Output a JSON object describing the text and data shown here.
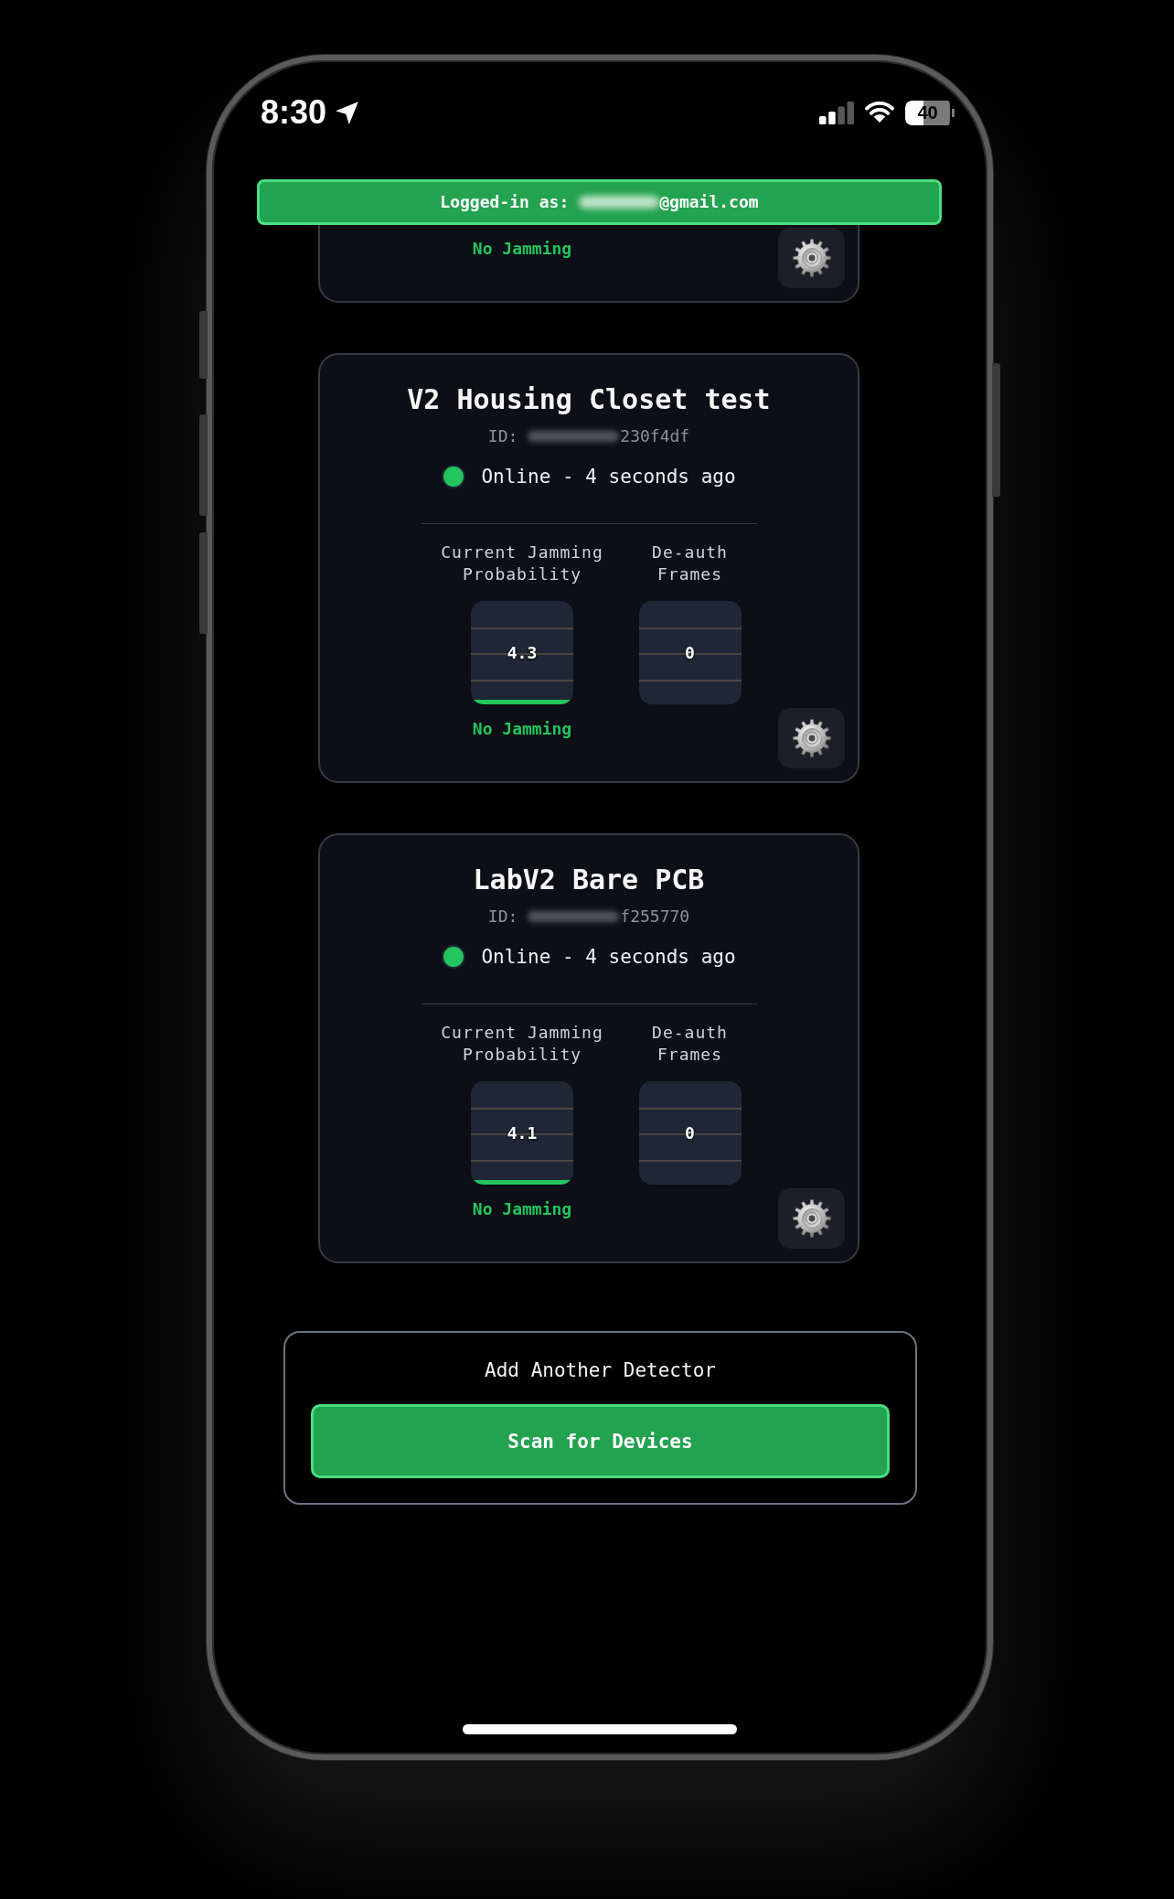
{
  "status_bar": {
    "time": "8:30",
    "battery": "40"
  },
  "login_banner": {
    "label": "Logged-in as:",
    "email_redacted": true,
    "email_domain": "@gmail.com"
  },
  "devices": [
    {
      "clipped_top": true,
      "metrics": [
        {
          "status": "No Jamming",
          "jamming": false
        }
      ]
    },
    {
      "clipped_top": false,
      "name": "V2 Housing Closet test",
      "id_label": "ID:",
      "id_redacted": true,
      "id_tail": "230f4df",
      "online": true,
      "last_seen": "Online - 4 seconds ago",
      "metrics": [
        {
          "label": "Current Jamming Probability",
          "value": "4.3",
          "level": 0.043,
          "status": "No Jamming",
          "jamming": false
        },
        {
          "label": "De-auth Frames",
          "value": "0"
        }
      ]
    },
    {
      "clipped_top": false,
      "name": "LabV2 Bare PCB",
      "id_label": "ID:",
      "id_redacted": true,
      "id_tail": "f255770",
      "online": true,
      "last_seen": "Online - 4 seconds ago",
      "metrics": [
        {
          "label": "Current Jamming Probability",
          "value": "4.1",
          "level": 0.041,
          "status": "No Jamming",
          "jamming": false
        },
        {
          "label": "De-auth Frames",
          "value": "0"
        }
      ]
    }
  ],
  "add_detector": {
    "title": "Add Another Detector",
    "button": "Scan for Devices"
  }
}
